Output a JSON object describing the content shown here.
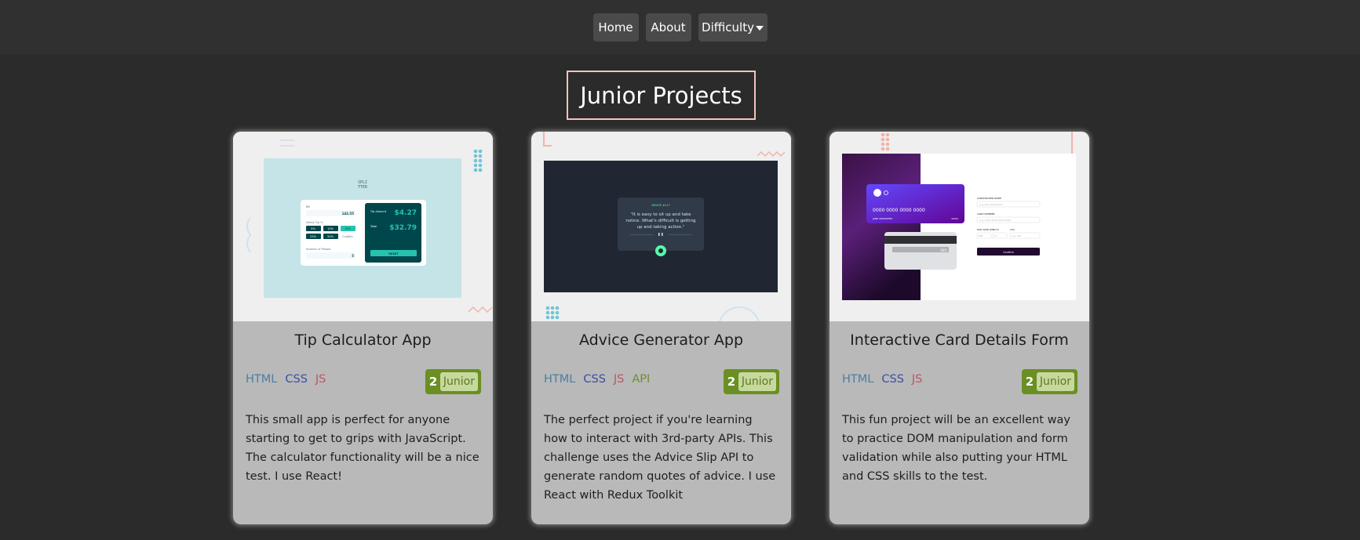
{
  "nav": {
    "home": "Home",
    "about": "About",
    "difficulty": "Difficulty"
  },
  "page_title": "Junior Projects",
  "colors": {
    "background": "#2b2b2b",
    "navbar": "#303030",
    "nav_button": "#4a4a4a",
    "heading_border": "#f2c4bd",
    "card_body": "#b9b9b9",
    "badge_green": "#6a8f22",
    "badge_label_bg": "#c7d89f",
    "tag_html": "#4d7fa0",
    "tag_css": "#3b4fa4",
    "tag_js": "#c05366",
    "tag_api": "#6d8f32"
  },
  "cards": [
    {
      "title": "Tip Calculator App",
      "tags": [
        "HTML",
        "CSS",
        "JS"
      ],
      "badge_level": "2",
      "badge_label": "Junior",
      "description": "This small app is perfect for anyone starting to get to grips with JavaScript. The calculator functionality will be a nice test. I use React!",
      "thumbnail": {
        "logo": [
          "SPLI",
          "TTER"
        ],
        "tip_label": "Tip Amount",
        "tip_value": "$4.27",
        "total_label": "Total",
        "total_value": "$32.79",
        "bill_label": "Bill",
        "bill_value": "142.55",
        "select_tip_label": "Select Tip %",
        "tip_options": [
          "5%",
          "10%",
          "15%",
          "25%",
          "50%",
          "Custom"
        ],
        "people_label": "Number of People",
        "people_value": "5",
        "reset_label": "RESET"
      }
    },
    {
      "title": "Advice Generator App",
      "tags": [
        "HTML",
        "CSS",
        "JS",
        "API"
      ],
      "badge_level": "2",
      "badge_label": "Junior",
      "description": "The perfect project if you're learning how to interact with 3rd-party APIs. This challenge uses the Advice Slip API to generate random quotes of advice. I use React with Redux Toolkit",
      "thumbnail": {
        "advice_number": "ADVICE #117",
        "quote_lines": [
          "\"It is easy to sit up and take",
          "notice. What's difficult is getting",
          "up and taking action.\""
        ]
      }
    },
    {
      "title": "Interactive Card Details Form",
      "tags": [
        "HTML",
        "CSS",
        "JS"
      ],
      "badge_level": "2",
      "badge_label": "Junior",
      "description": "This fun project will be an excellent way to practice DOM manipulation and form validation while also putting your HTML and CSS skills to the test.",
      "thumbnail": {
        "card_number": "0000 0000 0000 0000",
        "card_name": "JANE APPLESEED",
        "card_exp": "00/00",
        "card_cvc": "000",
        "cardholder_label": "CARDHOLDER NAME",
        "cardholder_placeholder": "e.g. Jane Appleseed",
        "number_label": "CARD NUMBER",
        "number_placeholder": "e.g. 1234 5678 9123 0000",
        "exp_label": "EXP. DATE (MM/YY)",
        "cvc_label": "CVC",
        "mm_placeholder": "MM",
        "yy_placeholder": "YY",
        "cvc_placeholder": "e.g. 123",
        "confirm_label": "Confirm"
      }
    }
  ]
}
